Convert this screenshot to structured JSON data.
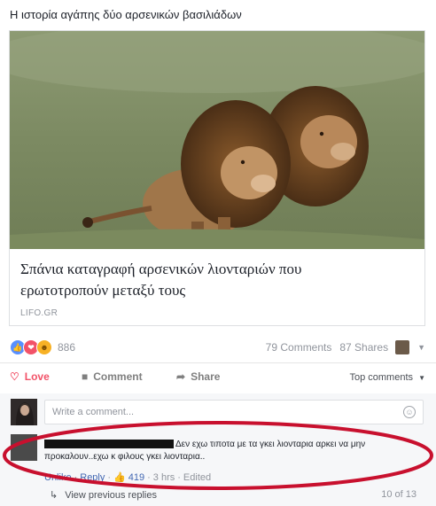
{
  "post": {
    "text": "Η ιστορία αγάπης δύο αρσενικών βασιλιάδων"
  },
  "link": {
    "title": "Σπάνια καταγραφή αρσενικών λιονταριών που ερωτοτροπούν μεταξύ τους",
    "domain": "LIFO.GR"
  },
  "reactions": {
    "count": "886",
    "comments": "79 Comments",
    "shares": "87 Shares"
  },
  "actions": {
    "love": "Love",
    "comment": "Comment",
    "share": "Share",
    "top_comments": "Top comments"
  },
  "composer": {
    "placeholder": "Write a comment..."
  },
  "comment": {
    "text": "Δεν εχω τιποτα με τα γκει λιονταρια αρκει να μην προκαλουν..εχω κ φιλους γκει λιονταρια..",
    "unlike": "Unlike",
    "reply": "Reply",
    "likes": "419",
    "time": "3 hrs",
    "edited": "Edited"
  },
  "footer": {
    "view_previous": "View previous replies",
    "pager": "10 of 13"
  },
  "colors": {
    "link_blue": "#4267b2",
    "love_red": "#f25268",
    "annotation_red": "#c8102e"
  },
  "icons": [
    "like-reaction-icon",
    "love-reaction-icon",
    "haha-reaction-icon",
    "heart-icon",
    "comment-icon",
    "share-arrow-icon",
    "smiley-icon",
    "thumbs-up-icon",
    "reply-arrow-icon",
    "caret-down-icon"
  ]
}
